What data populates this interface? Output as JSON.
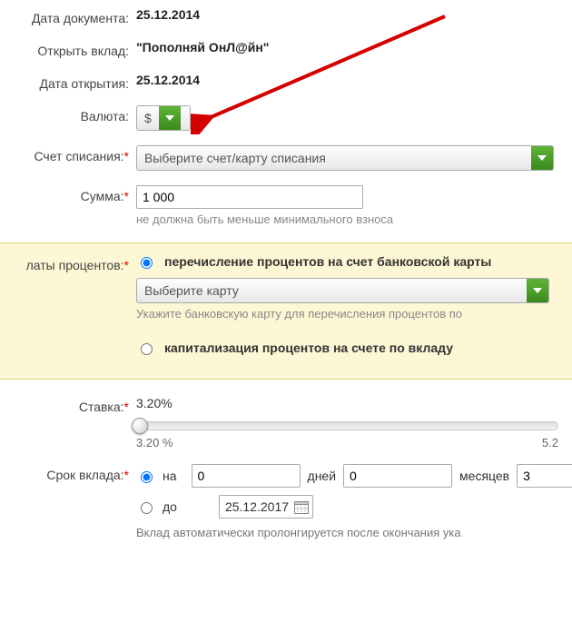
{
  "doc_date": {
    "label": "Дата документа:",
    "value": "25.12.2014"
  },
  "deposit": {
    "label": "Открыть вклад:",
    "value": "\"Пополняй ОнЛ@йн\""
  },
  "open_date": {
    "label": "Дата открытия:",
    "value": "25.12.2014"
  },
  "currency": {
    "label": "Валюта:",
    "selected": "$"
  },
  "debit_account": {
    "label": "Счет списания:",
    "placeholder": "Выберите счет/карту списания"
  },
  "amount": {
    "label": "Сумма:",
    "value": "1 000",
    "hint": "не должна быть меньше минимального взноса"
  },
  "interest": {
    "label": "латы процентов:",
    "opt_transfer": "перечисление процентов на счет банковской карты",
    "card_placeholder": "Выберите карту",
    "card_hint": "Укажите банковскую карту для перечисления процентов по",
    "opt_capitalize": "капитализация процентов на счете по вкладу"
  },
  "rate": {
    "label": "Ставка:",
    "value": "3.20%",
    "min": "3.20 %",
    "max": "5.2"
  },
  "term": {
    "label": "Срок вклада:",
    "opt_for": "на",
    "opt_until": "до",
    "days": "0",
    "days_label": "дней",
    "months": "0",
    "months_label": "месяцев",
    "years": "3",
    "until_date": "25.12.2017",
    "hint": "Вклад автоматически пролонгируется после окончания ука"
  }
}
